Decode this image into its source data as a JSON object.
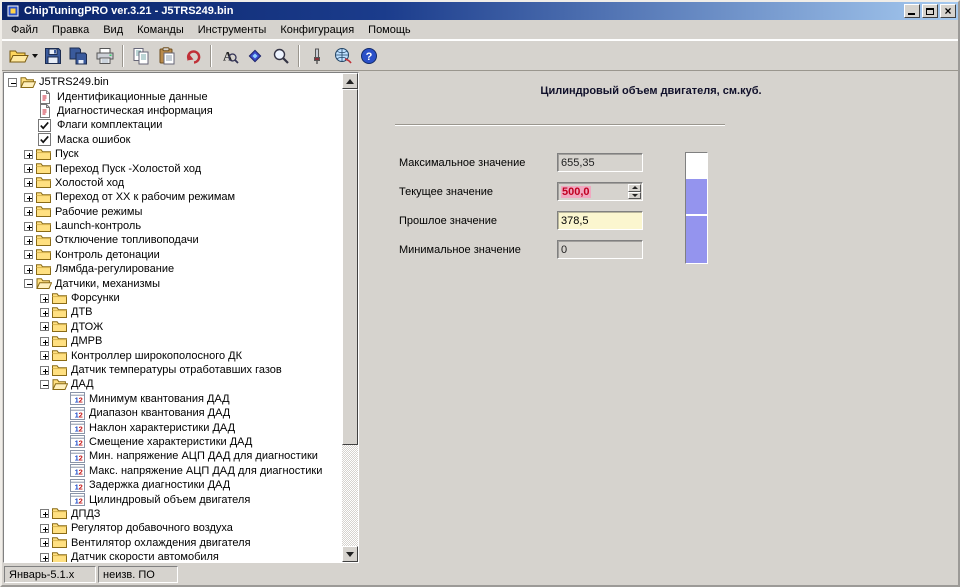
{
  "window": {
    "title": "ChipTuningPRO ver.3.21 - J5TRS249.bin",
    "controls": [
      {
        "name": "minimize-button",
        "icon": "minimize-icon"
      },
      {
        "name": "maximize-button",
        "icon": "maximize-icon"
      },
      {
        "name": "close-button",
        "icon": "close-icon",
        "glyph": "×"
      }
    ]
  },
  "menu": {
    "items": [
      "Файл",
      "Правка",
      "Вид",
      "Команды",
      "Инструменты",
      "Конфигурация",
      "Помощь"
    ]
  },
  "toolbar": {
    "items": [
      {
        "type": "button",
        "name": "open",
        "icon": "open-folder",
        "dropdown": true
      },
      {
        "type": "button",
        "name": "save",
        "icon": "floppy"
      },
      {
        "type": "button",
        "name": "save-all",
        "icon": "floppy-multi"
      },
      {
        "type": "button",
        "name": "print",
        "icon": "printer"
      },
      {
        "type": "separator"
      },
      {
        "type": "button",
        "name": "copy",
        "icon": "copy"
      },
      {
        "type": "button",
        "name": "paste",
        "icon": "paste"
      },
      {
        "type": "button",
        "name": "undo",
        "icon": "undo"
      },
      {
        "type": "separator"
      },
      {
        "type": "button",
        "name": "font",
        "icon": "font-magnifier"
      },
      {
        "type": "button",
        "name": "compare",
        "icon": "diamond"
      },
      {
        "type": "button",
        "name": "search",
        "icon": "magnifier"
      },
      {
        "type": "separator"
      },
      {
        "type": "button",
        "name": "tools",
        "icon": "tool"
      },
      {
        "type": "button",
        "name": "connection",
        "icon": "globe"
      },
      {
        "type": "button",
        "name": "help",
        "icon": "help"
      }
    ]
  },
  "tree": {
    "items": [
      {
        "label": "J5TRS249.bin",
        "depth": 0,
        "icon": "folder-open",
        "expander": "minus"
      },
      {
        "label": "Идентификационные данные",
        "depth": 1,
        "icon": "doc-red",
        "expander": null
      },
      {
        "label": "Диагностическая информация",
        "depth": 1,
        "icon": "doc-red",
        "expander": null
      },
      {
        "label": "Флаги комплектации",
        "depth": 1,
        "icon": "check",
        "expander": null
      },
      {
        "label": "Маска ошибок",
        "depth": 1,
        "icon": "check",
        "expander": null
      },
      {
        "label": "Пуск",
        "depth": 1,
        "icon": "folder",
        "expander": "plus"
      },
      {
        "label": "Переход Пуск -Холостой ход",
        "depth": 1,
        "icon": "folder",
        "expander": "plus"
      },
      {
        "label": "Холостой ход",
        "depth": 1,
        "icon": "folder",
        "expander": "plus"
      },
      {
        "label": "Переход от ХХ к рабочим режимам",
        "depth": 1,
        "icon": "folder",
        "expander": "plus"
      },
      {
        "label": "Рабочие режимы",
        "depth": 1,
        "icon": "folder",
        "expander": "plus"
      },
      {
        "label": "Launch-контроль",
        "depth": 1,
        "icon": "folder",
        "expander": "plus"
      },
      {
        "label": "Отключение топливоподачи",
        "depth": 1,
        "icon": "folder",
        "expander": "plus"
      },
      {
        "label": "Контроль детонации",
        "depth": 1,
        "icon": "folder",
        "expander": "plus"
      },
      {
        "label": "Лямбда-регулирование",
        "depth": 1,
        "icon": "folder",
        "expander": "plus"
      },
      {
        "label": "Датчики, механизмы",
        "depth": 1,
        "icon": "folder-open",
        "expander": "minus"
      },
      {
        "label": "Форсунки",
        "depth": 2,
        "icon": "folder",
        "expander": "plus"
      },
      {
        "label": "ДТВ",
        "depth": 2,
        "icon": "folder",
        "expander": "plus"
      },
      {
        "label": "ДТОЖ",
        "depth": 2,
        "icon": "folder",
        "expander": "plus"
      },
      {
        "label": "ДМРВ",
        "depth": 2,
        "icon": "folder",
        "expander": "plus"
      },
      {
        "label": "Контроллер широкополосного ДК",
        "depth": 2,
        "icon": "folder",
        "expander": "plus"
      },
      {
        "label": "Датчик температуры отработавших газов",
        "depth": 2,
        "icon": "folder",
        "expander": "plus"
      },
      {
        "label": "ДАД",
        "depth": 2,
        "icon": "folder-open",
        "expander": "minus"
      },
      {
        "label": "Минимум квантования ДАД",
        "depth": 3,
        "icon": "param",
        "expander": null
      },
      {
        "label": "Диапазон квантования ДАД",
        "depth": 3,
        "icon": "param",
        "expander": null
      },
      {
        "label": "Наклон характеристики ДАД",
        "depth": 3,
        "icon": "param",
        "expander": null
      },
      {
        "label": "Смещение характеристики ДАД",
        "depth": 3,
        "icon": "param",
        "expander": null
      },
      {
        "label": "Мин. напряжение АЦП ДАД для диагностики",
        "depth": 3,
        "icon": "param",
        "expander": null
      },
      {
        "label": "Макс. напряжение АЦП ДАД для диагностики",
        "depth": 3,
        "icon": "param",
        "expander": null
      },
      {
        "label": "Задержка диагностики ДАД",
        "depth": 3,
        "icon": "param",
        "expander": null
      },
      {
        "label": "Цилиндровый объем двигателя",
        "depth": 3,
        "icon": "param",
        "expander": null
      },
      {
        "label": "ДПДЗ",
        "depth": 2,
        "icon": "folder",
        "expander": "plus"
      },
      {
        "label": "Регулятор добавочного воздуха",
        "depth": 2,
        "icon": "folder",
        "expander": "plus"
      },
      {
        "label": "Вентилятор охлаждения двигателя",
        "depth": 2,
        "icon": "folder",
        "expander": "plus"
      },
      {
        "label": "Датчик скорости автомобиля",
        "depth": 2,
        "icon": "folder",
        "expander": "plus"
      }
    ]
  },
  "panel": {
    "title": "Цилиндровый объем двигателя, см.куб.",
    "fields": [
      {
        "name": "max",
        "label": "Максимальное значение",
        "value": "655,35",
        "style": "disabled",
        "spinner": false
      },
      {
        "name": "current",
        "label": "Текущее значение",
        "value": "500,0",
        "style": "current",
        "spinner": true
      },
      {
        "name": "past",
        "label": "Прошлое значение",
        "value": "378,5",
        "style": "past",
        "spinner": false
      },
      {
        "name": "min",
        "label": "Минимальное значение",
        "value": "0",
        "style": "disabled",
        "spinner": false
      }
    ],
    "gauge": {
      "fill_percent": 76,
      "divider_percent": 55,
      "fill_color": "#9494ee"
    }
  },
  "statusbar": {
    "segments": [
      {
        "text": "Январь-5.1.х",
        "width": 92
      },
      {
        "text": "неизв. ПО",
        "width": 80
      }
    ]
  },
  "colors": {
    "titlebar_start": "#0a246a",
    "titlebar_end": "#a6caf0",
    "current_value_text": "#c00020",
    "current_value_highlight": "#f0a8c0",
    "past_value_bg": "#fbf6cf",
    "gauge_fill": "#9494ee"
  }
}
